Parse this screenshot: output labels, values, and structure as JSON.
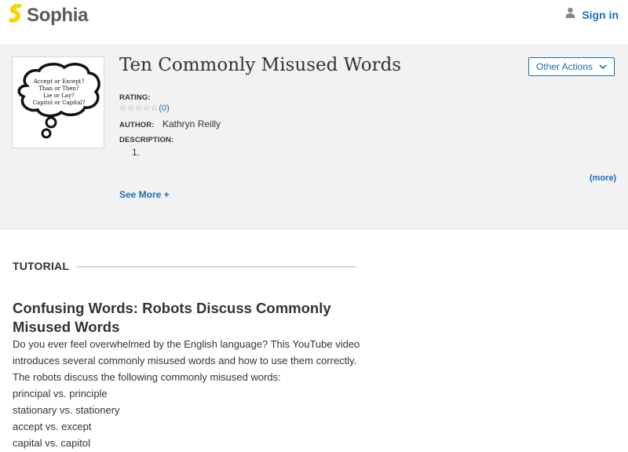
{
  "header": {
    "logo_text": "Sophia",
    "signin_label": "Sign in"
  },
  "hero": {
    "title": "Ten Commonly Misused Words",
    "other_actions_label": "Other Actions",
    "thumbnail_text": [
      "Accept or Except?",
      "Than or Then?",
      "Lie or Lay?",
      "Capitol or Capital?"
    ],
    "rating_label": "RATING:",
    "rating_count": "(0)",
    "stars": 5,
    "author_label": "AUTHOR:",
    "author_name": "Kathryn Reilly",
    "description_label": "DESCRIPTION:",
    "description_item": "1.",
    "more_label": "(more)",
    "see_more_label": "See More +"
  },
  "tutorial": {
    "label": "TUTORIAL",
    "heading": "Confusing Words: Robots Discuss Commonly Misused Words",
    "lines": [
      "Do you ever feel overwhelmed by the English language? This YouTube video",
      "introduces several commonly misused words and how to use them correctly.",
      "The robots discuss the following commonly misused words:",
      "principal vs. principle",
      "stationary vs. stationery",
      "accept vs. except",
      "capital vs. capitol"
    ]
  },
  "colors": {
    "brand_yellow": "#f5d50a",
    "link_blue": "#1a6fb7",
    "hero_bg": "#f2f2f2"
  },
  "icons": {
    "logo": "sophia-logo-icon",
    "signin": "person-icon",
    "dropdown": "chevron-down-icon",
    "rating": "star-icon"
  }
}
